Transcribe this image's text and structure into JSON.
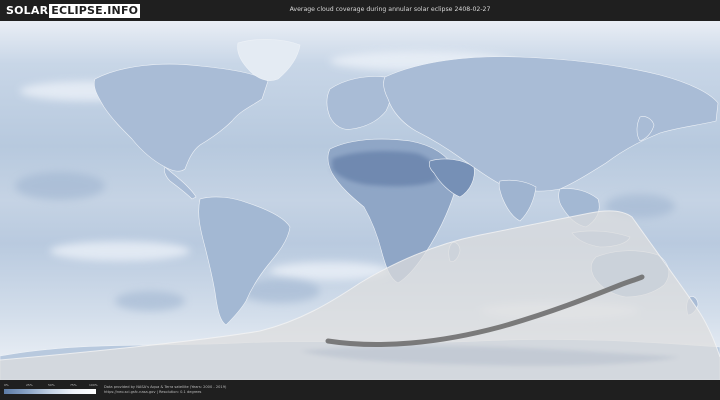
{
  "header": {
    "logo_part1": "SOLAR",
    "logo_part2": "ECLIPSE.INFO",
    "title": "Average cloud coverage during annular solar eclipse 2408-02-27"
  },
  "legend": {
    "ticks": [
      "0%",
      "25%",
      "50%",
      "75%",
      "100%"
    ]
  },
  "footer": {
    "credit_line1": "Data provided by NASA's Aqua & Terra satellite (Years: 2000 - 2019)",
    "credit_line2": "https://neo.sci.gsfc.nasa.gov | Resolution: 0.1 degrees"
  },
  "colors": {
    "background": "#1f1f1f",
    "ocean_cloud": "#c9d7e8",
    "land": "#9fb4d0",
    "desert": "#6c86ad",
    "eclipse_path": "#6b6b6b",
    "penumbra": "#d8d8d8"
  }
}
